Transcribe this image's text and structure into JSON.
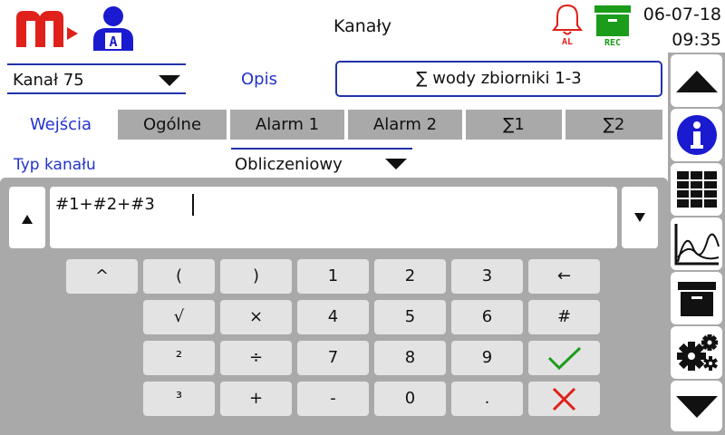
{
  "header": {
    "title": "Kanały",
    "alarm_label": "AL",
    "rec_label": "REC",
    "date": "06-07-18",
    "time": "09:35"
  },
  "colors": {
    "brand_red": "#e0201a",
    "accent_blue": "#2233cc",
    "rec_green": "#1b9c1b",
    "panel_gray": "#a9a9a9",
    "key_gray": "#e3e3e3"
  },
  "channel": {
    "value": "Kanał 75"
  },
  "description": {
    "label": "Opis",
    "value": "∑ wody zbiorniki 1-3"
  },
  "tabs": [
    {
      "label": "Wejścia"
    },
    {
      "label": "Ogólne"
    },
    {
      "label": "Alarm 1"
    },
    {
      "label": "Alarm 2"
    },
    {
      "label": "∑1"
    },
    {
      "label": "∑2"
    }
  ],
  "channel_type": {
    "label": "Typ kanału",
    "value": "Obliczeniowy"
  },
  "formula": {
    "value": "#1+#2+#3"
  },
  "keyboard": {
    "row1": [
      "^",
      "(",
      ")",
      "1",
      "2",
      "3",
      "←"
    ],
    "row2": [
      "√",
      "×",
      "4",
      "5",
      "6",
      "#"
    ],
    "row3": [
      "²",
      "÷",
      "7",
      "8",
      "9"
    ],
    "row4": [
      "³",
      "+",
      "-",
      "0",
      "."
    ]
  },
  "sidebar_icons": [
    "arrow-up-icon",
    "info-icon",
    "table-icon",
    "chart-icon",
    "archive-icon",
    "settings-icon",
    "arrow-down-icon"
  ]
}
